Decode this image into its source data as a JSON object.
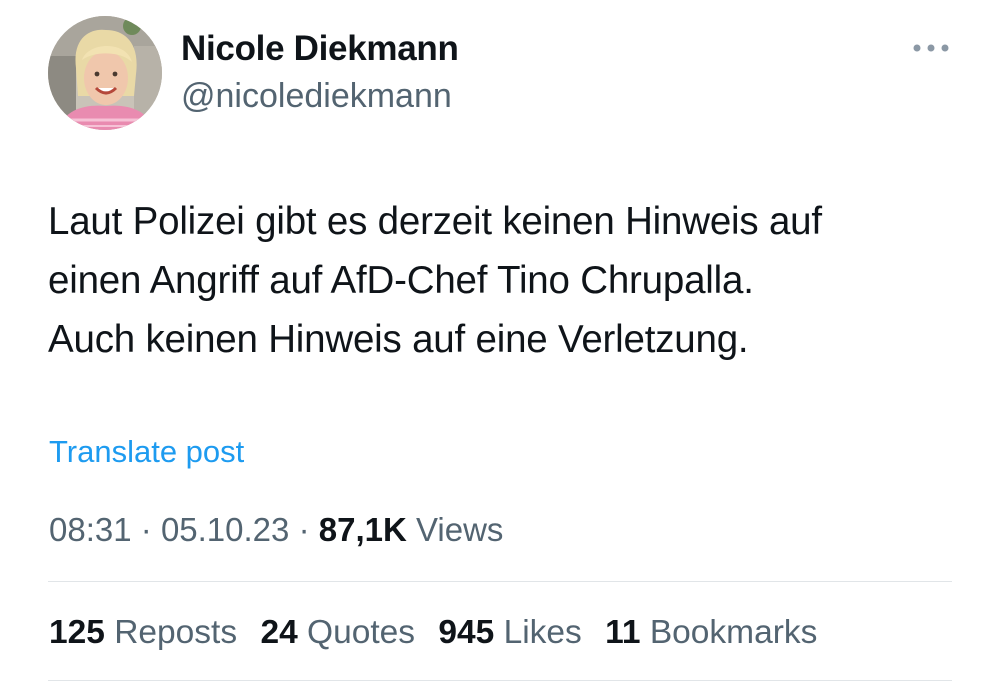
{
  "author": {
    "display_name": "Nicole Diekmann",
    "handle": "@nicolediekmann"
  },
  "tweet": {
    "lines": [
      "Laut Polizei gibt es derzeit keinen Hinweis auf",
      "einen Angriff auf AfD-Chef Tino Chrupalla.",
      "Auch keinen Hinweis auf eine Verletzung."
    ],
    "translate_label": "Translate post"
  },
  "meta": {
    "time": "08:31",
    "separator": "·",
    "date": "05.10.23",
    "views_count": "87,1K",
    "views_label": "Views"
  },
  "stats": [
    {
      "count": "125",
      "label": "Reposts"
    },
    {
      "count": "24",
      "label": "Quotes"
    },
    {
      "count": "945",
      "label": "Likes"
    },
    {
      "count": "11",
      "label": "Bookmarks"
    }
  ],
  "colors": {
    "text": "#0f1419",
    "secondary": "#536471",
    "link": "#1d9bf0",
    "divider": "#e1e5e8"
  },
  "icons": {
    "more": "more-horizontal-icon"
  }
}
